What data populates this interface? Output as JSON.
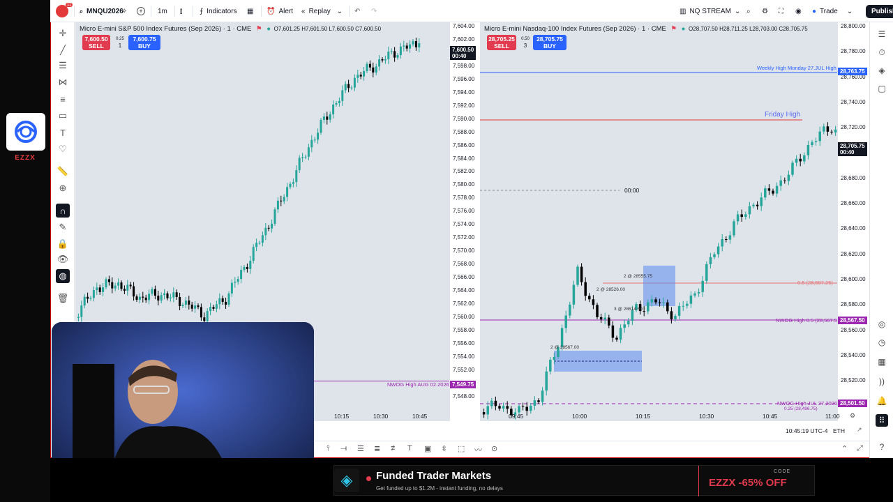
{
  "brand": {
    "name": "EZZX"
  },
  "topbar": {
    "notif_count": "11",
    "symbol": "MNQU2026",
    "interval": "1m",
    "indicators_label": "Indicators",
    "alert_label": "Alert",
    "replay_label": "Replay",
    "layout_name": "NQ STREAM",
    "trade_label": "Trade",
    "publish_label": "Publish"
  },
  "chart1": {
    "title": "Micro E-mini S&P 500 Index Futures (Sep 2026) · 1 · CME",
    "ohlc": "O7,601.25 H7,601.50 L7,600.50 C7,600.50",
    "sell_price": "7,600.50",
    "sell_label": "SELL",
    "spread": "0.25",
    "qty": "1",
    "buy_price": "7,600.75",
    "buy_label": "BUY",
    "price_labels": [
      "7,604.00",
      "7,602.00",
      "7,600.00",
      "7,598.00",
      "7,596.00",
      "7,594.00",
      "7,592.00",
      "7,590.00",
      "7,588.00",
      "7,586.00",
      "7,584.00",
      "7,582.00",
      "7,580.00",
      "7,578.00",
      "7,576.00",
      "7,574.00",
      "7,572.00",
      "7,570.00",
      "7,568.00",
      "7,566.00",
      "7,564.00",
      "7,562.00",
      "7,560.00",
      "7,558.00",
      "7,556.00",
      "7,554.00",
      "7,552.00",
      "7,550.00",
      "7,548.00"
    ],
    "current_price": "7,600.50",
    "current_time": "00:40",
    "nwog_label": "NWOG High AUG 02.2026",
    "nwog_price": "7,549.75",
    "time_labels": [
      "10:15",
      "10:30",
      "10:45"
    ]
  },
  "chart2": {
    "title": "Micro E-mini Nasdaq-100 Index Futures (Sep 2026) · 1 · CME",
    "ohlc": "O28,707.50 H28,711.25 L28,703.00 C28,705.75",
    "sell_price": "28,705.25",
    "sell_label": "SELL",
    "spread": "0.50",
    "qty": "3",
    "buy_price": "28,705.75",
    "buy_label": "BUY",
    "price_labels": [
      "28,800.00",
      "28,780.00",
      "28,760.00",
      "28,740.00",
      "28,720.00",
      "28,700.00",
      "28,680.00",
      "28,660.00",
      "28,640.00",
      "28,620.00",
      "28,600.00",
      "28,580.00",
      "28,560.00",
      "28,540.00",
      "28,520.00"
    ],
    "weekly_high_label": "Weekly High Monday 27.JUL High",
    "weekly_high_price": "28,763.75",
    "friday_high_label": "Friday High",
    "current_price": "28,705.75",
    "current_time": "00:40",
    "session_label": "00:00",
    "fib_label": "0.5 (28,597.25)",
    "nwog_high_label": "NWOG High 0.5 (28,567.50)",
    "nwog_high_price": "28,567.50",
    "nwog_jul_label": "NWOG High JUL 27.2026",
    "nwog_jul_sub": "0.25 (28,496.75)",
    "nwog_jul_price": "28,501.50",
    "trade_notes": [
      "2 @ 28555.75",
      "2 @ 28526.00",
      "3 @ 28614.50",
      "2 @ 28567.00"
    ],
    "time_labels": [
      "09:45",
      "10:00",
      "10:15",
      "10:30",
      "10:45",
      "11:00"
    ]
  },
  "status": {
    "clock": "10:45:19 UTC-4",
    "session": "ETH"
  },
  "banner": {
    "title": "Funded Trader Markets",
    "subtitle": "Get funded up to $1.2M - instant funding, no delays",
    "code_label": "CODE",
    "code_value": "EZZX -65% OFF"
  },
  "colors": {
    "up": "#26a69a",
    "down": "#000000",
    "sell": "#e23a4e",
    "buy": "#2962ff",
    "nwog": "#9c27b0",
    "friday": "#e53935"
  }
}
